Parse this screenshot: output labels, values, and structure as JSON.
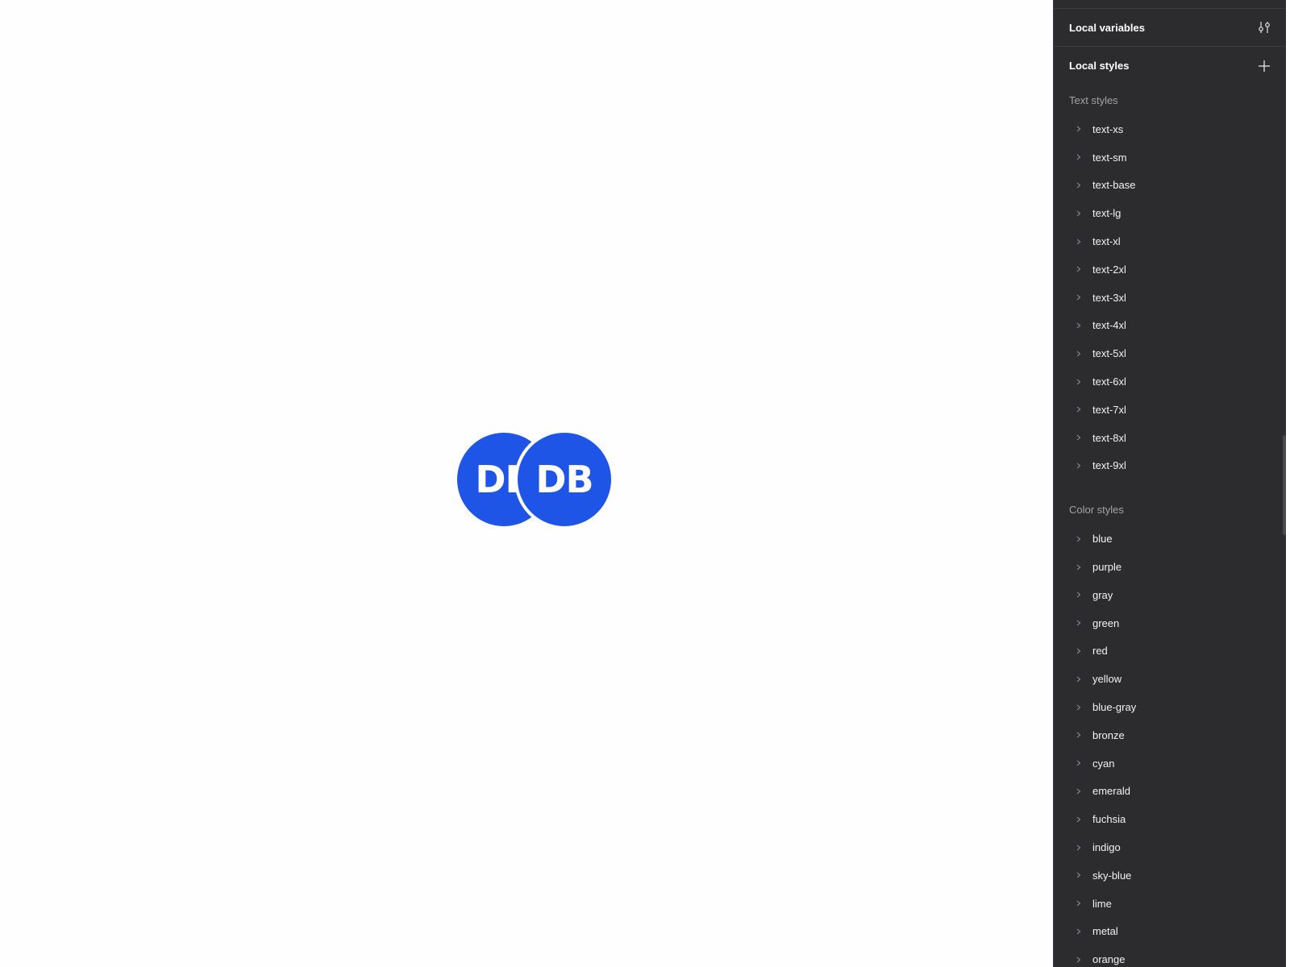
{
  "avatars": {
    "back_initials": "DB",
    "front_initials": "DB",
    "color": "#1f55e6"
  },
  "panel": {
    "variables_title": "Local variables",
    "variables_icon": "sliders-icon",
    "styles_title": "Local styles",
    "styles_icon": "plus-icon",
    "text_section_label": "Text styles",
    "text_styles": [
      "text-xs",
      "text-sm",
      "text-base",
      "text-lg",
      "text-xl",
      "text-2xl",
      "text-3xl",
      "text-4xl",
      "text-5xl",
      "text-6xl",
      "text-7xl",
      "text-8xl",
      "text-9xl"
    ],
    "color_section_label": "Color styles",
    "color_styles": [
      "blue",
      "purple",
      "gray",
      "green",
      "red",
      "yellow",
      "blue-gray",
      "bronze",
      "cyan",
      "emerald",
      "fuchsia",
      "indigo",
      "sky-blue",
      "lime",
      "metal",
      "orange"
    ]
  }
}
